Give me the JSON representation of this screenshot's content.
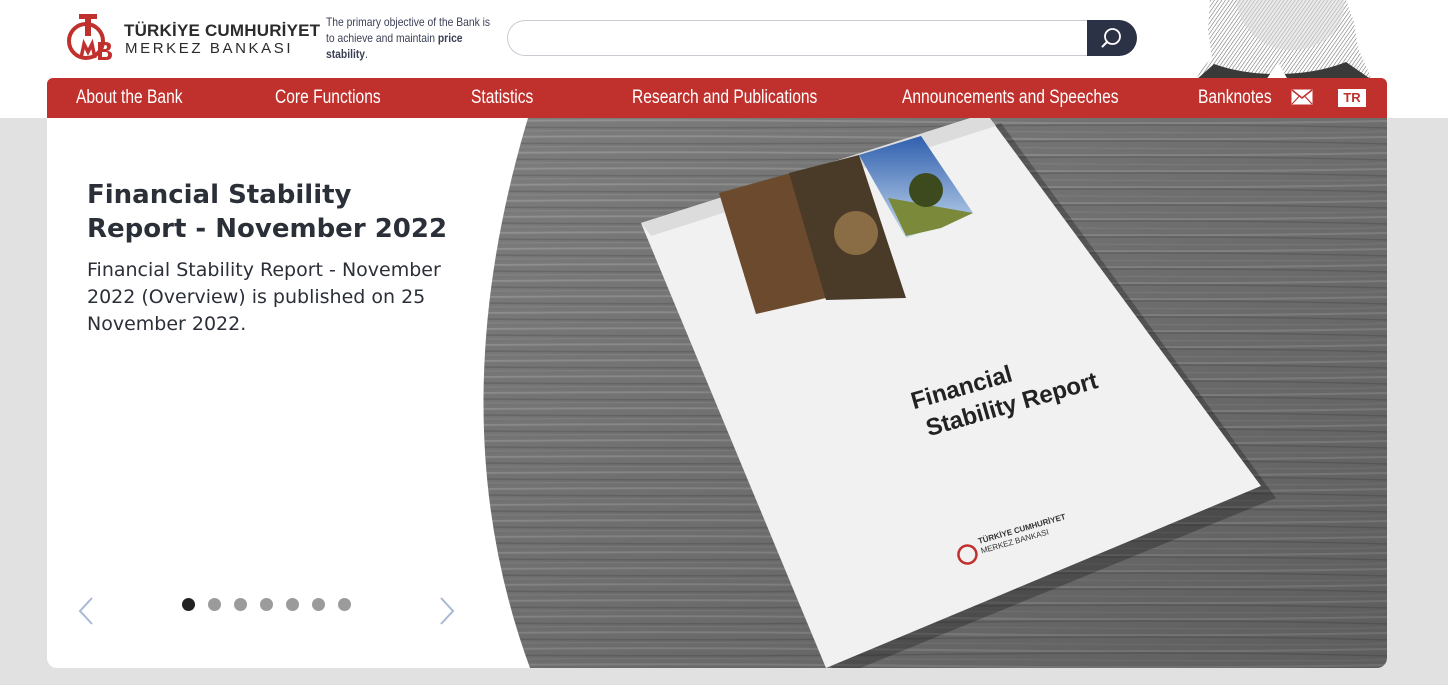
{
  "logo": {
    "line1": "TÜRKİYE CUMHURİYET",
    "line2": "MERKEZ BANKASI",
    "mark_text": "TCMB",
    "icon": "tcmb-logo-icon"
  },
  "objective": {
    "prefix": "The primary objective of the Bank is to achieve and maintain",
    "bold": "price stability",
    "suffix": "."
  },
  "search": {
    "placeholder": "",
    "value": "",
    "button_icon": "search-icon"
  },
  "nav": {
    "items": [
      {
        "label": "About the Bank"
      },
      {
        "label": "Core Functions"
      },
      {
        "label": "Statistics"
      },
      {
        "label": "Research and Publications"
      },
      {
        "label": "Announcements and Speeches"
      },
      {
        "label": "Banknotes"
      }
    ],
    "mail_icon": "mail-icon",
    "language": "TR"
  },
  "slide": {
    "title": "Financial Stability Report - November 2022",
    "description": "Financial Stability Report - November 2022 (Overview) is published on 25 November 2022.",
    "image_text_line1": "Financial",
    "image_text_line2": "Stability Report",
    "image_logo_line1": "TÜRKİYE CUMHURİYET",
    "image_logo_line2": "MERKEZ BANKASI",
    "prev_icon": "chevron-left-icon",
    "next_icon": "chevron-right-icon",
    "dot_count": 7,
    "active_index": 1
  },
  "colors": {
    "brand_red": "#c0312d",
    "dark": "#2c3245",
    "background": "#e1e1e1"
  }
}
